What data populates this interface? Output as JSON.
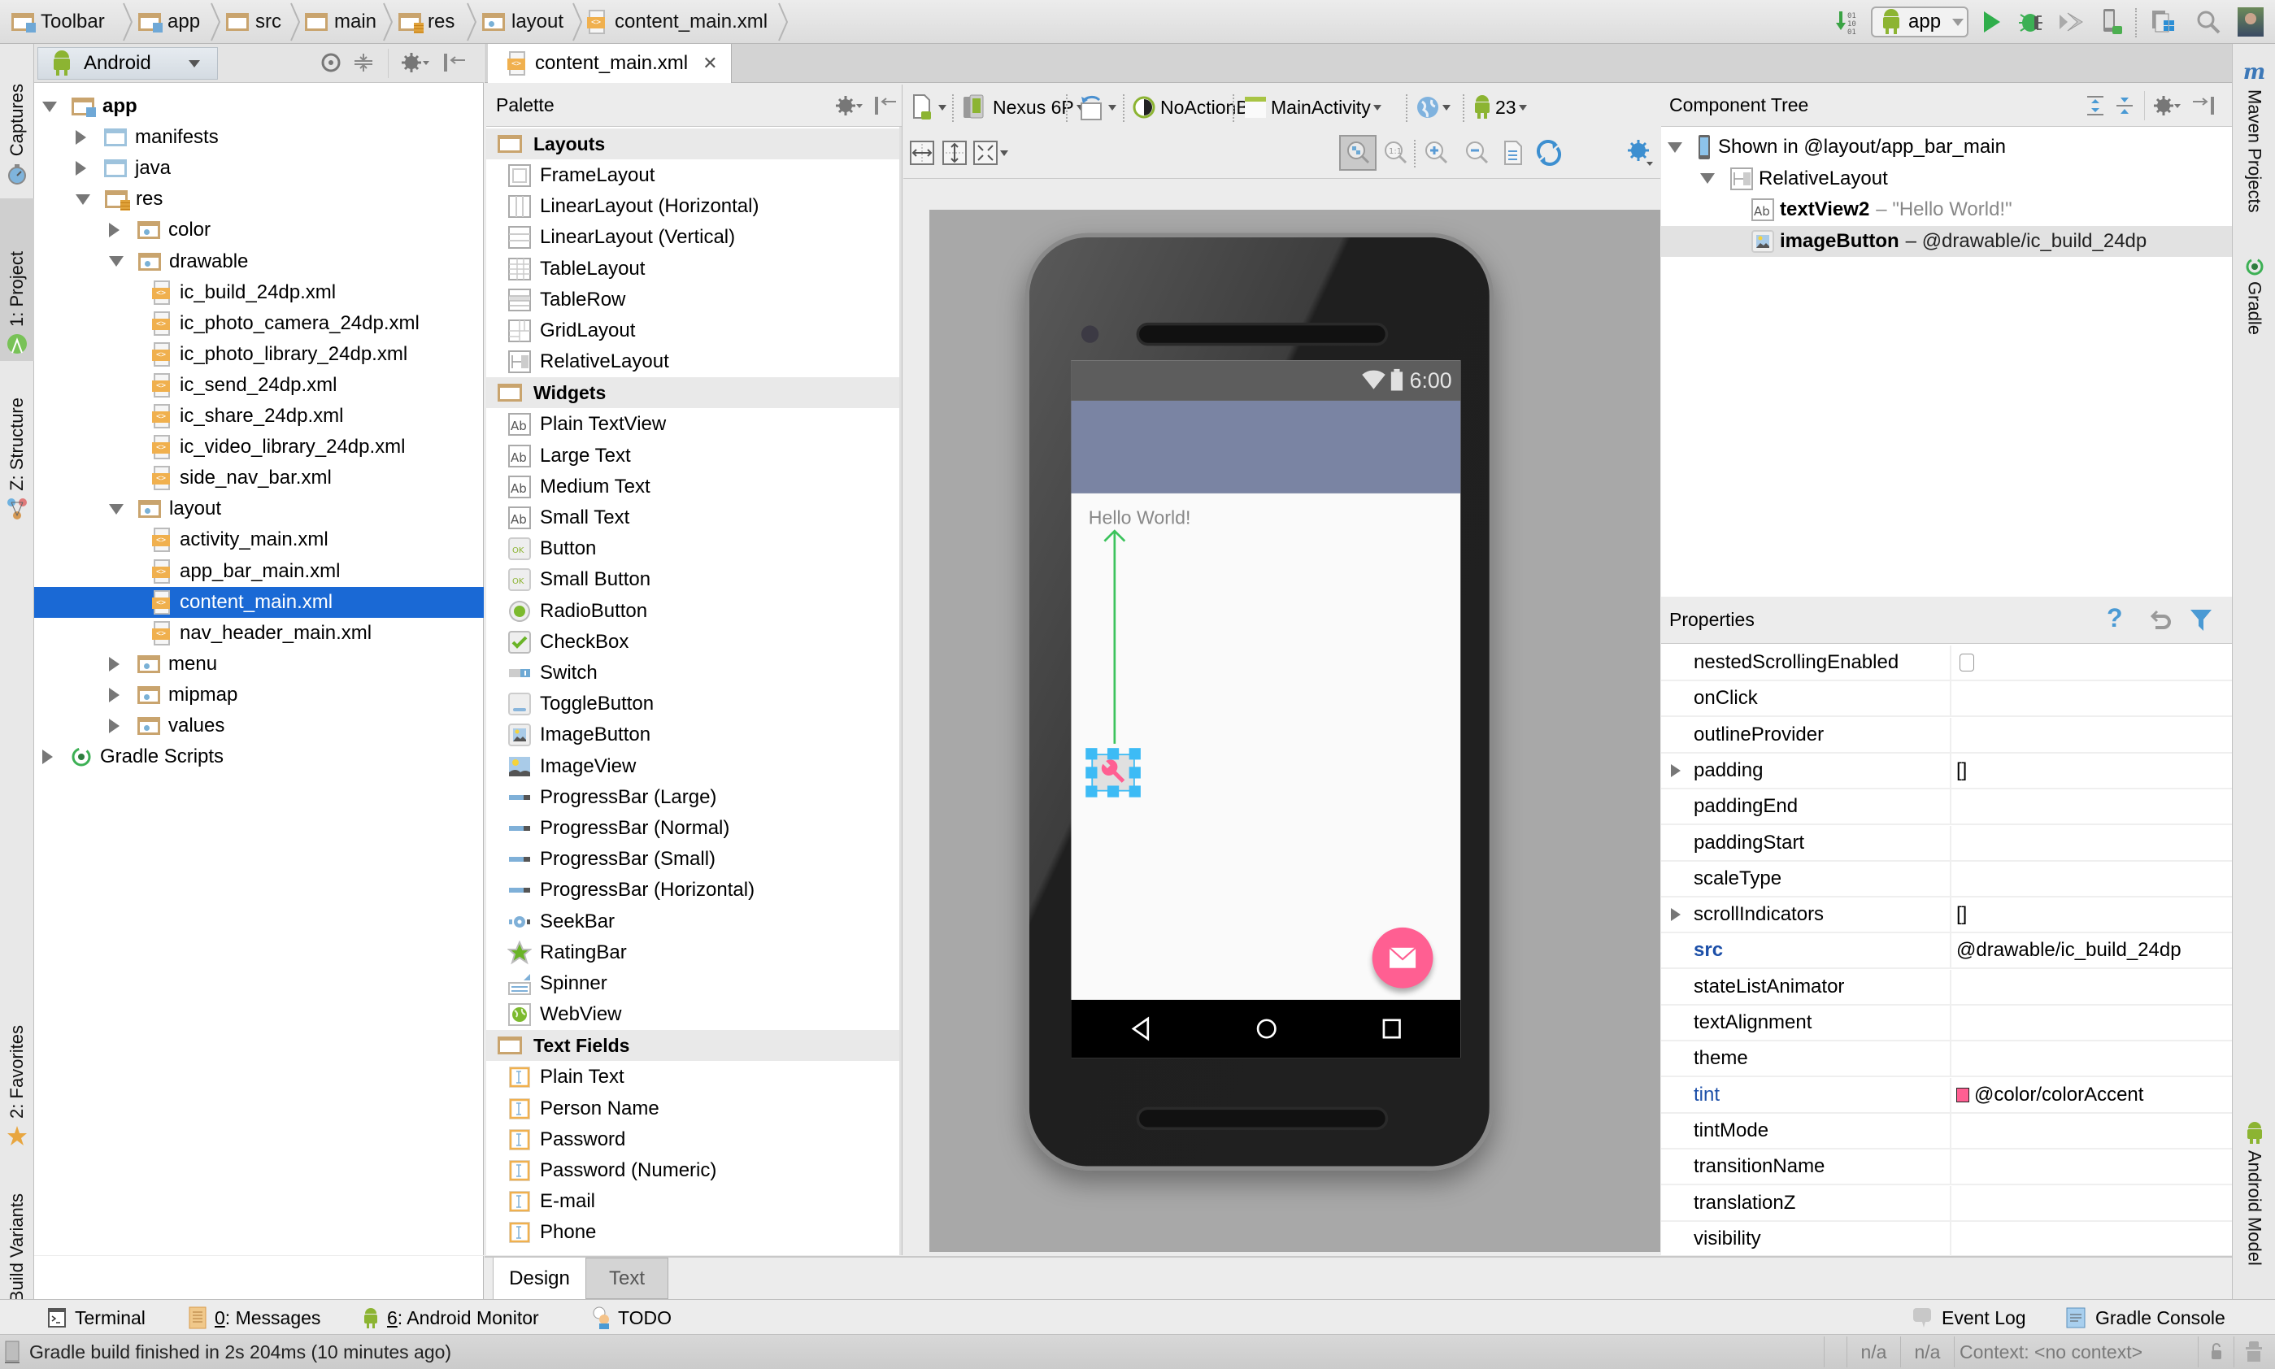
{
  "breadcrumb": [
    {
      "label": "Toolbar",
      "icon": "module-folder-icon"
    },
    {
      "label": "app",
      "icon": "module-folder-icon"
    },
    {
      "label": "src",
      "icon": "folder-icon"
    },
    {
      "label": "main",
      "icon": "folder-icon"
    },
    {
      "label": "res",
      "icon": "resource-folder-icon"
    },
    {
      "label": "layout",
      "icon": "package-folder-icon"
    },
    {
      "label": "content_main.xml",
      "icon": "xml-file-icon"
    }
  ],
  "run_toolbar": {
    "config_label": "app",
    "icons": [
      "make-project-icon",
      "android-icon",
      "run-icon",
      "debug-icon",
      "attach-debugger-icon",
      "avd-manager-icon",
      "sdk-manager-icon",
      "search-icon",
      "user-avatar"
    ]
  },
  "left_strip": {
    "tabs": [
      {
        "label": "Captures",
        "icon": "captures-icon"
      },
      {
        "label": "1: Project",
        "icon": "android-studio-icon"
      },
      {
        "label": "Z: Structure",
        "icon": "structure-icon"
      },
      {
        "label": "2: Favorites",
        "icon": "star-icon"
      },
      {
        "label": "Build Variants",
        "icon": "android-icon"
      }
    ]
  },
  "right_strip": {
    "tabs": [
      {
        "label": "Maven Projects",
        "icon": "maven-icon"
      },
      {
        "label": "Gradle",
        "icon": "gradle-icon"
      },
      {
        "label": "Android Model",
        "icon": "android-icon"
      }
    ]
  },
  "project_panel": {
    "view_selector": "Android",
    "tree": [
      {
        "label": "app",
        "depth": 0,
        "state": "expanded",
        "icon": "module-folder",
        "bold": true
      },
      {
        "label": "manifests",
        "depth": 1,
        "state": "collapsed",
        "icon": "blue-folder"
      },
      {
        "label": "java",
        "depth": 1,
        "state": "collapsed",
        "icon": "blue-folder"
      },
      {
        "label": "res",
        "depth": 1,
        "state": "expanded",
        "icon": "res-folder"
      },
      {
        "label": "color",
        "depth": 2,
        "state": "collapsed",
        "icon": "pkg-folder"
      },
      {
        "label": "drawable",
        "depth": 2,
        "state": "expanded",
        "icon": "pkg-folder"
      },
      {
        "label": "ic_build_24dp.xml",
        "depth": 3,
        "state": "leaf",
        "icon": "xml"
      },
      {
        "label": "ic_photo_camera_24dp.xml",
        "depth": 3,
        "state": "leaf",
        "icon": "xml"
      },
      {
        "label": "ic_photo_library_24dp.xml",
        "depth": 3,
        "state": "leaf",
        "icon": "xml"
      },
      {
        "label": "ic_send_24dp.xml",
        "depth": 3,
        "state": "leaf",
        "icon": "xml"
      },
      {
        "label": "ic_share_24dp.xml",
        "depth": 3,
        "state": "leaf",
        "icon": "xml"
      },
      {
        "label": "ic_video_library_24dp.xml",
        "depth": 3,
        "state": "leaf",
        "icon": "xml"
      },
      {
        "label": "side_nav_bar.xml",
        "depth": 3,
        "state": "leaf",
        "icon": "xml"
      },
      {
        "label": "layout",
        "depth": 2,
        "state": "expanded",
        "icon": "pkg-folder"
      },
      {
        "label": "activity_main.xml",
        "depth": 3,
        "state": "leaf",
        "icon": "xml"
      },
      {
        "label": "app_bar_main.xml",
        "depth": 3,
        "state": "leaf",
        "icon": "xml"
      },
      {
        "label": "content_main.xml",
        "depth": 3,
        "state": "leaf",
        "icon": "xml",
        "selected": true
      },
      {
        "label": "nav_header_main.xml",
        "depth": 3,
        "state": "leaf",
        "icon": "xml"
      },
      {
        "label": "menu",
        "depth": 2,
        "state": "collapsed",
        "icon": "pkg-folder"
      },
      {
        "label": "mipmap",
        "depth": 2,
        "state": "collapsed",
        "icon": "pkg-folder"
      },
      {
        "label": "values",
        "depth": 2,
        "state": "collapsed",
        "icon": "pkg-folder"
      },
      {
        "label": "Gradle Scripts",
        "depth": 0,
        "state": "collapsed",
        "icon": "gradle"
      }
    ]
  },
  "editor": {
    "tab_label": "content_main.xml",
    "bottom_tabs": [
      {
        "label": "Design",
        "active": true
      },
      {
        "label": "Text",
        "active": false
      }
    ]
  },
  "palette": {
    "title": "Palette",
    "groups": [
      {
        "name": "Layouts",
        "items": [
          {
            "label": "FrameLayout",
            "icon": "frame-layout-icon"
          },
          {
            "label": "LinearLayout (Horizontal)",
            "icon": "linear-horizontal-icon"
          },
          {
            "label": "LinearLayout (Vertical)",
            "icon": "linear-vertical-icon"
          },
          {
            "label": "TableLayout",
            "icon": "table-layout-icon"
          },
          {
            "label": "TableRow",
            "icon": "table-row-icon"
          },
          {
            "label": "GridLayout",
            "icon": "grid-layout-icon"
          },
          {
            "label": "RelativeLayout",
            "icon": "relative-layout-icon"
          }
        ]
      },
      {
        "name": "Widgets",
        "items": [
          {
            "label": "Plain TextView",
            "icon": "textview-icon"
          },
          {
            "label": "Large Text",
            "icon": "textview-icon"
          },
          {
            "label": "Medium Text",
            "icon": "textview-icon"
          },
          {
            "label": "Small Text",
            "icon": "textview-icon"
          },
          {
            "label": "Button",
            "icon": "button-icon"
          },
          {
            "label": "Small Button",
            "icon": "button-icon"
          },
          {
            "label": "RadioButton",
            "icon": "radio-icon"
          },
          {
            "label": "CheckBox",
            "icon": "checkbox-icon"
          },
          {
            "label": "Switch",
            "icon": "switch-icon"
          },
          {
            "label": "ToggleButton",
            "icon": "toggle-icon"
          },
          {
            "label": "ImageButton",
            "icon": "image-button-icon"
          },
          {
            "label": "ImageView",
            "icon": "image-view-icon"
          },
          {
            "label": "ProgressBar (Large)",
            "icon": "progress-icon"
          },
          {
            "label": "ProgressBar (Normal)",
            "icon": "progress-icon"
          },
          {
            "label": "ProgressBar (Small)",
            "icon": "progress-icon"
          },
          {
            "label": "ProgressBar (Horizontal)",
            "icon": "progress-icon"
          },
          {
            "label": "SeekBar",
            "icon": "seekbar-icon"
          },
          {
            "label": "RatingBar",
            "icon": "ratingbar-icon"
          },
          {
            "label": "Spinner",
            "icon": "spinner-icon"
          },
          {
            "label": "WebView",
            "icon": "webview-icon"
          }
        ]
      },
      {
        "name": "Text Fields",
        "items": [
          {
            "label": "Plain Text",
            "icon": "edittext-icon"
          },
          {
            "label": "Person Name",
            "icon": "edittext-icon"
          },
          {
            "label": "Password",
            "icon": "edittext-icon"
          },
          {
            "label": "Password (Numeric)",
            "icon": "edittext-icon"
          },
          {
            "label": "E-mail",
            "icon": "edittext-icon"
          },
          {
            "label": "Phone",
            "icon": "edittext-icon"
          }
        ]
      }
    ]
  },
  "design_toolbar": {
    "device": "Nexus 6P",
    "theme": "NoActionBar",
    "activity": "MainActivity",
    "api_level": "23"
  },
  "device_preview": {
    "status_time": "6:00",
    "hello_text": "Hello World!",
    "app_bar_color": "#7a84a3",
    "accent_color": "#ff5f92",
    "selection_color": "#3dbbf5",
    "constraint_color": "#3cc35c"
  },
  "component_tree": {
    "title": "Component Tree",
    "rows": [
      {
        "label": "Shown in @layout/app_bar_main",
        "depth": 0,
        "state": "expanded",
        "icon": "device-icon"
      },
      {
        "label": "RelativeLayout",
        "depth": 1,
        "state": "expanded",
        "icon": "relative-layout-icon"
      },
      {
        "id": "textView2",
        "detail": "\"Hello World!\"",
        "depth": 2,
        "state": "leaf",
        "icon": "textview-icon"
      },
      {
        "id": "imageButton",
        "detail": "@drawable/ic_build_24dp",
        "depth": 2,
        "state": "leaf",
        "icon": "image-button-icon",
        "selected": true
      }
    ]
  },
  "properties": {
    "title": "Properties",
    "rows": [
      {
        "name": "nestedScrollingEnabled",
        "value": "",
        "type": "checkbox",
        "checked": false
      },
      {
        "name": "onClick",
        "value": ""
      },
      {
        "name": "outlineProvider",
        "value": ""
      },
      {
        "name": "padding",
        "value": "[]",
        "expandable": true
      },
      {
        "name": "paddingEnd",
        "value": ""
      },
      {
        "name": "paddingStart",
        "value": ""
      },
      {
        "name": "scaleType",
        "value": ""
      },
      {
        "name": "scrollIndicators",
        "value": "[]",
        "expandable": true
      },
      {
        "name": "src",
        "value": "@drawable/ic_build_24dp",
        "style": "blue-bold"
      },
      {
        "name": "stateListAnimator",
        "value": ""
      },
      {
        "name": "textAlignment",
        "value": ""
      },
      {
        "name": "theme",
        "value": ""
      },
      {
        "name": "tint",
        "value": "@color/colorAccent",
        "style": "blue",
        "swatch": "#ff5f92"
      },
      {
        "name": "tintMode",
        "value": ""
      },
      {
        "name": "transitionName",
        "value": ""
      },
      {
        "name": "translationZ",
        "value": ""
      },
      {
        "name": "visibility",
        "value": ""
      }
    ]
  },
  "tool_windows": {
    "left": [
      {
        "label": "Terminal",
        "icon": "terminal-icon"
      },
      {
        "mnemonic": "0",
        "label": ": Messages",
        "icon": "messages-icon"
      },
      {
        "mnemonic": "6",
        "label": ": Android Monitor",
        "icon": "android-icon"
      },
      {
        "label": "TODO",
        "icon": "todo-icon"
      }
    ],
    "right": [
      {
        "label": "Event Log",
        "icon": "event-log-icon"
      },
      {
        "label": "Gradle Console",
        "icon": "gradle-console-icon"
      }
    ]
  },
  "status_bar": {
    "message": "Gradle build finished in 2s 204ms (10 minutes ago)",
    "cells": [
      "n/a",
      "n/a",
      "Context: <no context>"
    ]
  }
}
